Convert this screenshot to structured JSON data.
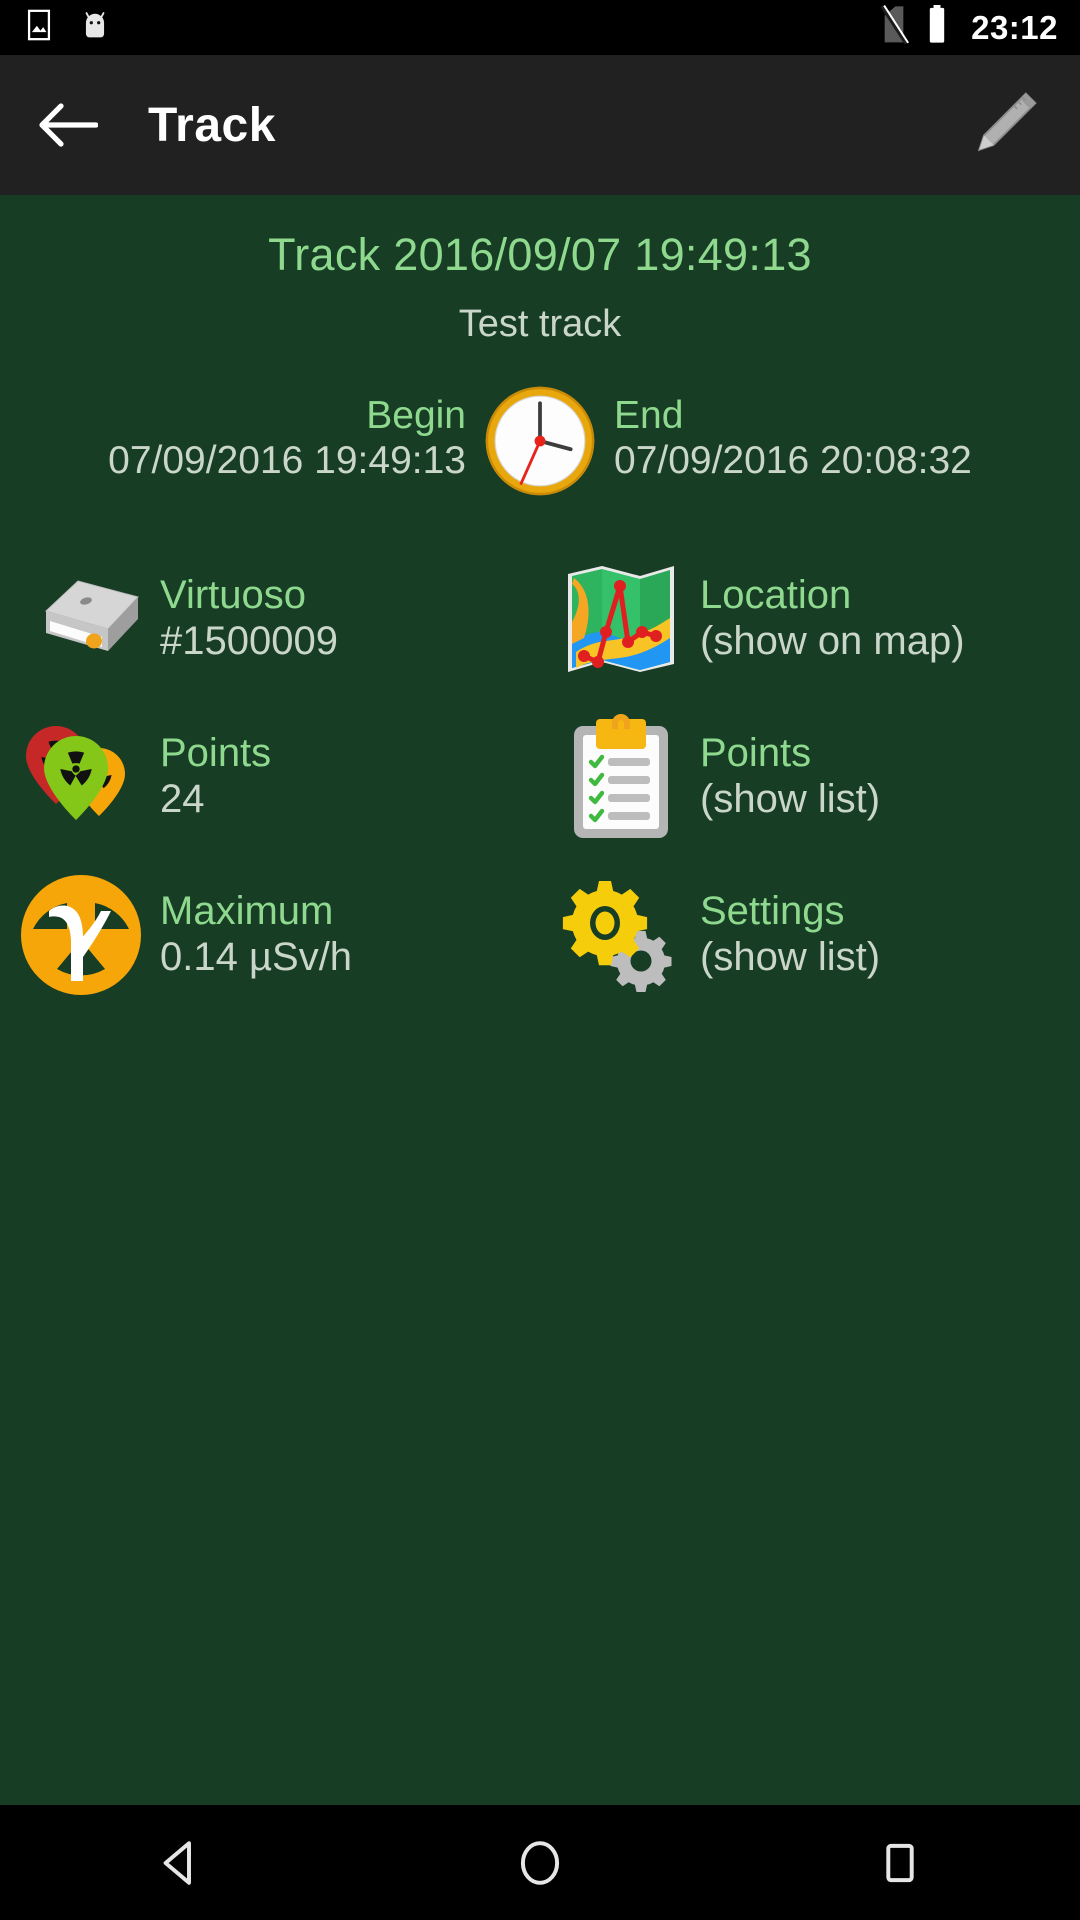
{
  "statusbar": {
    "time": "23:12",
    "icons": [
      "gallery-icon",
      "android-mascot-icon",
      "no-sim-icon",
      "battery-icon"
    ]
  },
  "appbar": {
    "back_label": "back-arrow-icon",
    "title": "Track",
    "edit_label": "pencil-edit-icon"
  },
  "header": {
    "title": "Track 2016/09/07 19:49:13",
    "subtitle": "Test track"
  },
  "time_range": {
    "begin_label": "Begin",
    "begin_value": "07/09/2016 19:49:13",
    "end_label": "End",
    "end_value": "07/09/2016 20:08:32",
    "clock_icon": "analog-clock-icon"
  },
  "tiles": [
    {
      "name": "device",
      "icon": "hard-drive-icon",
      "label": "Virtuoso",
      "value": "#1500009"
    },
    {
      "name": "location",
      "icon": "map-route-icon",
      "label": "Location",
      "value": "(show on map)"
    },
    {
      "name": "points-count",
      "icon": "radiation-markers-icon",
      "label": "Points",
      "value": "24"
    },
    {
      "name": "points-list",
      "icon": "clipboard-checklist-icon",
      "label": "Points",
      "value": "(show list)"
    },
    {
      "name": "maximum",
      "icon": "gamma-radiation-icon",
      "label": "Maximum",
      "value": "0.14 µSv/h"
    },
    {
      "name": "settings",
      "icon": "gears-icon",
      "label": "Settings",
      "value": "(show list)"
    }
  ],
  "navbar": {
    "back": "nav-back-triangle-icon",
    "home": "nav-home-circle-icon",
    "recents": "nav-recents-square-icon"
  },
  "colors": {
    "background": "#173d25",
    "appbar": "#212121",
    "accent_green": "#8fd98f",
    "value_text": "#c9d6c9",
    "status_bar": "#000000"
  }
}
